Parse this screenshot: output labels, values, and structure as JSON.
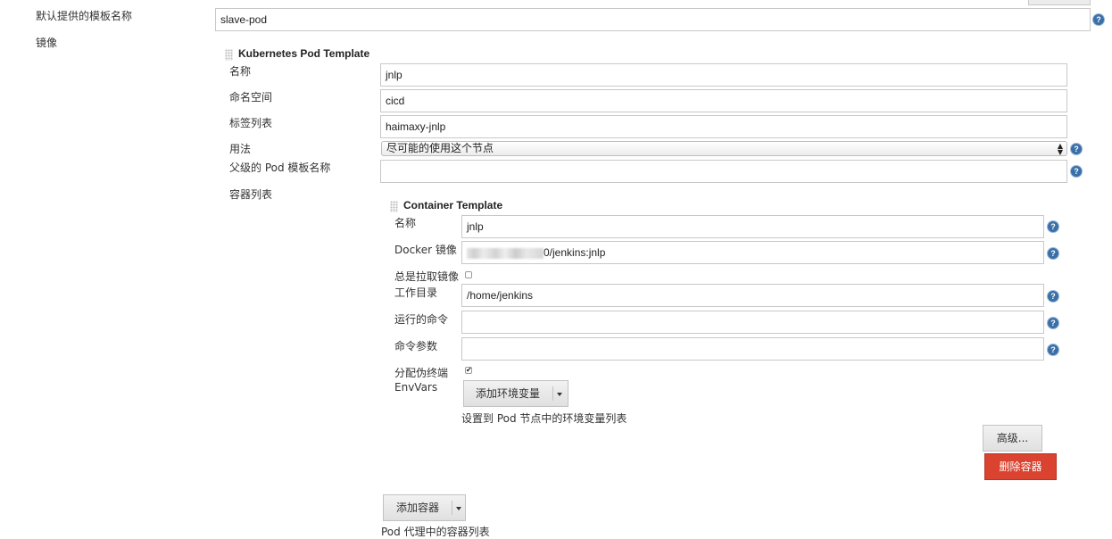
{
  "top": {
    "default_template_label": "默认提供的模板名称",
    "default_template_value": "slave-pod",
    "image_label": "镜像"
  },
  "pod": {
    "title": "Kubernetes Pod Template",
    "name_label": "名称",
    "name_value": "jnlp",
    "namespace_label": "命名空间",
    "namespace_value": "cicd",
    "labels_label": "标签列表",
    "labels_value": "haimaxy-jnlp",
    "usage_label": "用法",
    "usage_value": "尽可能的使用这个节点",
    "parent_label": "父级的 Pod 模板名称",
    "parent_value": "",
    "containers_label": "容器列表"
  },
  "container": {
    "title": "Container Template",
    "name_label": "名称",
    "name_value": "jnlp",
    "docker_label": "Docker 镜像",
    "docker_value_suffix": "0/jenkins:jnlp",
    "always_pull_label": "总是拉取镜像",
    "always_pull_checked": false,
    "workdir_label": "工作目录",
    "workdir_value": "/home/jenkins",
    "command_label": "运行的命令",
    "command_value": "",
    "args_label": "命令参数",
    "args_value": "",
    "tty_label": "分配伪终端",
    "tty_checked": true,
    "envvars_label": "EnvVars",
    "add_env_label": "添加环境变量",
    "env_hint": "设置到 Pod 节点中的环境变量列表",
    "advanced_label": "高级...",
    "delete_label": "删除容器"
  },
  "footer": {
    "add_container_label": "添加容器",
    "containers_hint": "Pod 代理中的容器列表"
  },
  "icons": {
    "help": "help-icon",
    "checkmark": "✔"
  },
  "colors": {
    "help": "#3a6fa8",
    "danger": "#d9432f"
  }
}
